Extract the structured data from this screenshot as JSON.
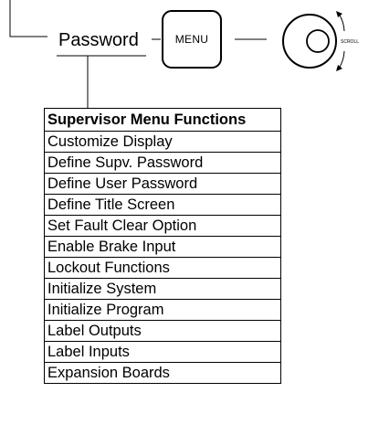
{
  "password_label": "Password",
  "menu_button_label": "MENU",
  "scroll_label": "SCROLL",
  "menu_table": {
    "title": "Supervisor Menu Functions",
    "items": [
      "Customize Display",
      "Define Supv. Password",
      "Define User Password",
      "Define Title Screen",
      "Set Fault Clear Option",
      "Enable Brake Input",
      "Lockout Functions",
      "Initialize System",
      "Initialize Program",
      "Label Outputs",
      "Label Inputs",
      "Expansion Boards"
    ]
  }
}
